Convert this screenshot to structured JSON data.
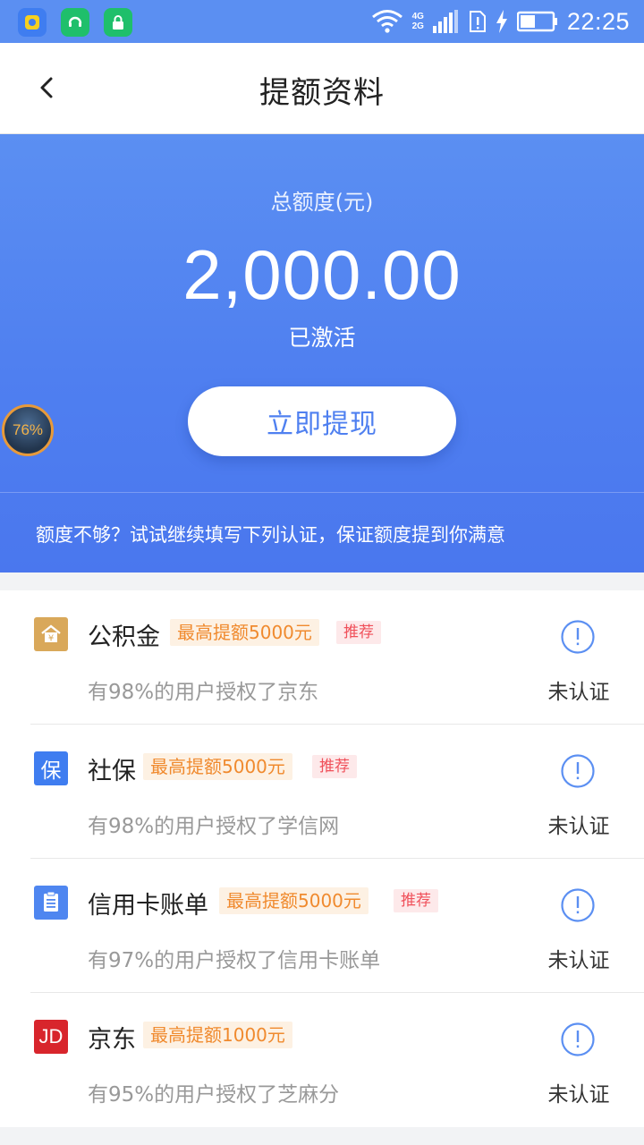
{
  "status_bar": {
    "time": "22:25",
    "network_top": "4G",
    "network_bottom": "2G"
  },
  "header": {
    "title": "提额资料"
  },
  "hero": {
    "label": "总额度(元)",
    "amount": "2,000.00",
    "status": "已激活",
    "button_label": "立即提现",
    "tip": "额度不够？试试继续填写下列认证，保证额度提到你满意"
  },
  "float_ball": {
    "percent": "76%"
  },
  "items": [
    {
      "name": "公积金",
      "limit_tag": "最高提额5000元",
      "recommend_tag": "推荐",
      "desc": "有98%的用户授权了京东",
      "status": "未认证",
      "icon": "house-fund-icon",
      "color": "#d9a85a"
    },
    {
      "name": "社保",
      "limit_tag": "最高提额5000元",
      "recommend_tag": "推荐",
      "desc": "有98%的用户授权了学信网",
      "status": "未认证",
      "icon_text": "保",
      "icon": "social-security-icon",
      "color": "#3f7df0"
    },
    {
      "name": "信用卡账单",
      "limit_tag": "最高提额5000元",
      "recommend_tag": "推荐",
      "desc": "有97%的用户授权了信用卡账单",
      "status": "未认证",
      "icon": "bill-icon",
      "color": "#4f86f0"
    },
    {
      "name": "京东",
      "limit_tag": "最高提额1000元",
      "desc": "有95%的用户授权了芝麻分",
      "status": "未认证",
      "icon_text": "JD",
      "icon": "jd-icon",
      "color": "#d8252c"
    }
  ],
  "colors": {
    "primary": "#4f80f0",
    "tag_orange": "#f08a2e",
    "tag_red": "#f0505a",
    "status_icon": "#5b8ff2"
  }
}
